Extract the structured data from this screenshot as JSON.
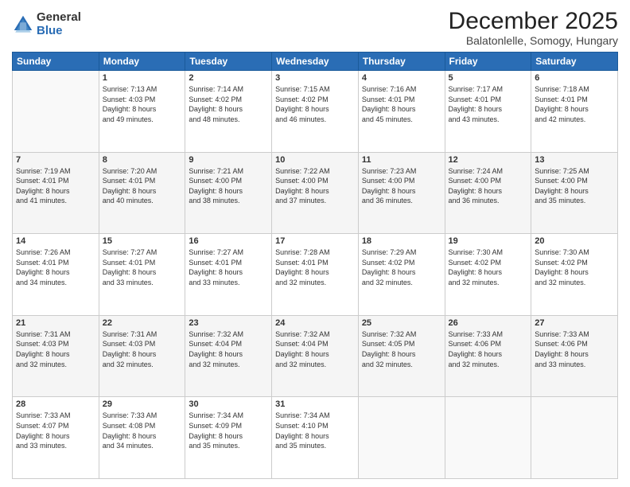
{
  "logo": {
    "general": "General",
    "blue": "Blue"
  },
  "title": "December 2025",
  "location": "Balatonlelle, Somogy, Hungary",
  "days_header": [
    "Sunday",
    "Monday",
    "Tuesday",
    "Wednesday",
    "Thursday",
    "Friday",
    "Saturday"
  ],
  "weeks": [
    [
      {
        "num": "",
        "info": ""
      },
      {
        "num": "1",
        "info": "Sunrise: 7:13 AM\nSunset: 4:03 PM\nDaylight: 8 hours\nand 49 minutes."
      },
      {
        "num": "2",
        "info": "Sunrise: 7:14 AM\nSunset: 4:02 PM\nDaylight: 8 hours\nand 48 minutes."
      },
      {
        "num": "3",
        "info": "Sunrise: 7:15 AM\nSunset: 4:02 PM\nDaylight: 8 hours\nand 46 minutes."
      },
      {
        "num": "4",
        "info": "Sunrise: 7:16 AM\nSunset: 4:01 PM\nDaylight: 8 hours\nand 45 minutes."
      },
      {
        "num": "5",
        "info": "Sunrise: 7:17 AM\nSunset: 4:01 PM\nDaylight: 8 hours\nand 43 minutes."
      },
      {
        "num": "6",
        "info": "Sunrise: 7:18 AM\nSunset: 4:01 PM\nDaylight: 8 hours\nand 42 minutes."
      }
    ],
    [
      {
        "num": "7",
        "info": "Sunrise: 7:19 AM\nSunset: 4:01 PM\nDaylight: 8 hours\nand 41 minutes."
      },
      {
        "num": "8",
        "info": "Sunrise: 7:20 AM\nSunset: 4:01 PM\nDaylight: 8 hours\nand 40 minutes."
      },
      {
        "num": "9",
        "info": "Sunrise: 7:21 AM\nSunset: 4:00 PM\nDaylight: 8 hours\nand 38 minutes."
      },
      {
        "num": "10",
        "info": "Sunrise: 7:22 AM\nSunset: 4:00 PM\nDaylight: 8 hours\nand 37 minutes."
      },
      {
        "num": "11",
        "info": "Sunrise: 7:23 AM\nSunset: 4:00 PM\nDaylight: 8 hours\nand 36 minutes."
      },
      {
        "num": "12",
        "info": "Sunrise: 7:24 AM\nSunset: 4:00 PM\nDaylight: 8 hours\nand 36 minutes."
      },
      {
        "num": "13",
        "info": "Sunrise: 7:25 AM\nSunset: 4:00 PM\nDaylight: 8 hours\nand 35 minutes."
      }
    ],
    [
      {
        "num": "14",
        "info": "Sunrise: 7:26 AM\nSunset: 4:01 PM\nDaylight: 8 hours\nand 34 minutes."
      },
      {
        "num": "15",
        "info": "Sunrise: 7:27 AM\nSunset: 4:01 PM\nDaylight: 8 hours\nand 33 minutes."
      },
      {
        "num": "16",
        "info": "Sunrise: 7:27 AM\nSunset: 4:01 PM\nDaylight: 8 hours\nand 33 minutes."
      },
      {
        "num": "17",
        "info": "Sunrise: 7:28 AM\nSunset: 4:01 PM\nDaylight: 8 hours\nand 32 minutes."
      },
      {
        "num": "18",
        "info": "Sunrise: 7:29 AM\nSunset: 4:02 PM\nDaylight: 8 hours\nand 32 minutes."
      },
      {
        "num": "19",
        "info": "Sunrise: 7:30 AM\nSunset: 4:02 PM\nDaylight: 8 hours\nand 32 minutes."
      },
      {
        "num": "20",
        "info": "Sunrise: 7:30 AM\nSunset: 4:02 PM\nDaylight: 8 hours\nand 32 minutes."
      }
    ],
    [
      {
        "num": "21",
        "info": "Sunrise: 7:31 AM\nSunset: 4:03 PM\nDaylight: 8 hours\nand 32 minutes."
      },
      {
        "num": "22",
        "info": "Sunrise: 7:31 AM\nSunset: 4:03 PM\nDaylight: 8 hours\nand 32 minutes."
      },
      {
        "num": "23",
        "info": "Sunrise: 7:32 AM\nSunset: 4:04 PM\nDaylight: 8 hours\nand 32 minutes."
      },
      {
        "num": "24",
        "info": "Sunrise: 7:32 AM\nSunset: 4:04 PM\nDaylight: 8 hours\nand 32 minutes."
      },
      {
        "num": "25",
        "info": "Sunrise: 7:32 AM\nSunset: 4:05 PM\nDaylight: 8 hours\nand 32 minutes."
      },
      {
        "num": "26",
        "info": "Sunrise: 7:33 AM\nSunset: 4:06 PM\nDaylight: 8 hours\nand 32 minutes."
      },
      {
        "num": "27",
        "info": "Sunrise: 7:33 AM\nSunset: 4:06 PM\nDaylight: 8 hours\nand 33 minutes."
      }
    ],
    [
      {
        "num": "28",
        "info": "Sunrise: 7:33 AM\nSunset: 4:07 PM\nDaylight: 8 hours\nand 33 minutes."
      },
      {
        "num": "29",
        "info": "Sunrise: 7:33 AM\nSunset: 4:08 PM\nDaylight: 8 hours\nand 34 minutes."
      },
      {
        "num": "30",
        "info": "Sunrise: 7:34 AM\nSunset: 4:09 PM\nDaylight: 8 hours\nand 35 minutes."
      },
      {
        "num": "31",
        "info": "Sunrise: 7:34 AM\nSunset: 4:10 PM\nDaylight: 8 hours\nand 35 minutes."
      },
      {
        "num": "",
        "info": ""
      },
      {
        "num": "",
        "info": ""
      },
      {
        "num": "",
        "info": ""
      }
    ]
  ]
}
